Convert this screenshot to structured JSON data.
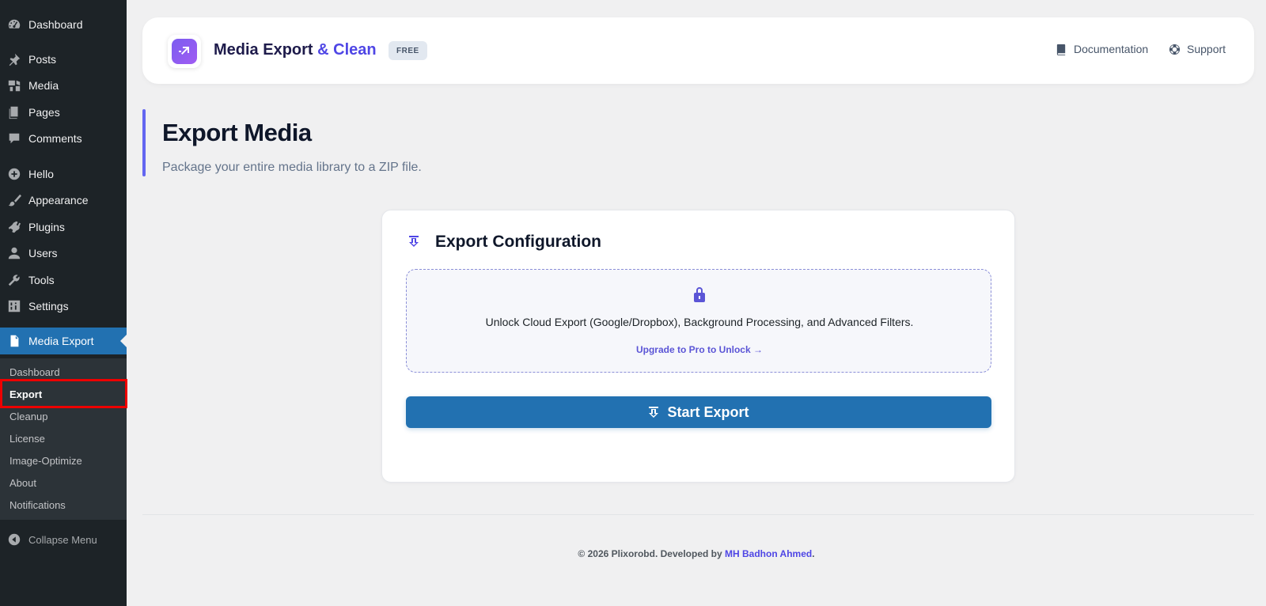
{
  "sidebar": {
    "items": [
      {
        "label": "Dashboard",
        "icon": "dashboard-icon"
      },
      {
        "label": "Posts",
        "icon": "pin-icon"
      },
      {
        "label": "Media",
        "icon": "media-icon"
      },
      {
        "label": "Pages",
        "icon": "pages-icon"
      },
      {
        "label": "Comments",
        "icon": "comments-icon"
      },
      {
        "label": "Hello",
        "icon": "plus-circle-icon"
      },
      {
        "label": "Appearance",
        "icon": "paintbrush-icon"
      },
      {
        "label": "Plugins",
        "icon": "plugins-icon"
      },
      {
        "label": "Users",
        "icon": "users-icon"
      },
      {
        "label": "Tools",
        "icon": "wrench-icon"
      },
      {
        "label": "Settings",
        "icon": "settings-icon"
      },
      {
        "label": "Media Export",
        "icon": "document-icon"
      }
    ],
    "submenu": [
      {
        "label": "Dashboard"
      },
      {
        "label": "Export"
      },
      {
        "label": "Cleanup"
      },
      {
        "label": "License"
      },
      {
        "label": "Image-Optimize"
      },
      {
        "label": "About"
      },
      {
        "label": "Notifications"
      }
    ],
    "collapse_label": "Collapse Menu"
  },
  "header": {
    "title_main": "Media Export ",
    "title_accent": "& Clean",
    "badge": "FREE",
    "links": {
      "documentation": "Documentation",
      "support": "Support"
    }
  },
  "page": {
    "title": "Export Media",
    "subtitle": "Package your entire media library to a ZIP file."
  },
  "card": {
    "title": "Export Configuration",
    "pro_message": "Unlock Cloud Export (Google/Dropbox), Background Processing, and Advanced Filters.",
    "pro_link": "Upgrade to Pro to Unlock →",
    "button_label": "Start Export"
  },
  "footer": {
    "text": "© 2026 Plixorobd. Developed by ",
    "author": "MH Badhon Ahmed",
    "end": "."
  },
  "colors": {
    "sidebar_bg": "#1d2327",
    "submenu_bg": "#2c3338",
    "active_blue": "#2271b1",
    "accent_indigo": "#4f46e5"
  }
}
